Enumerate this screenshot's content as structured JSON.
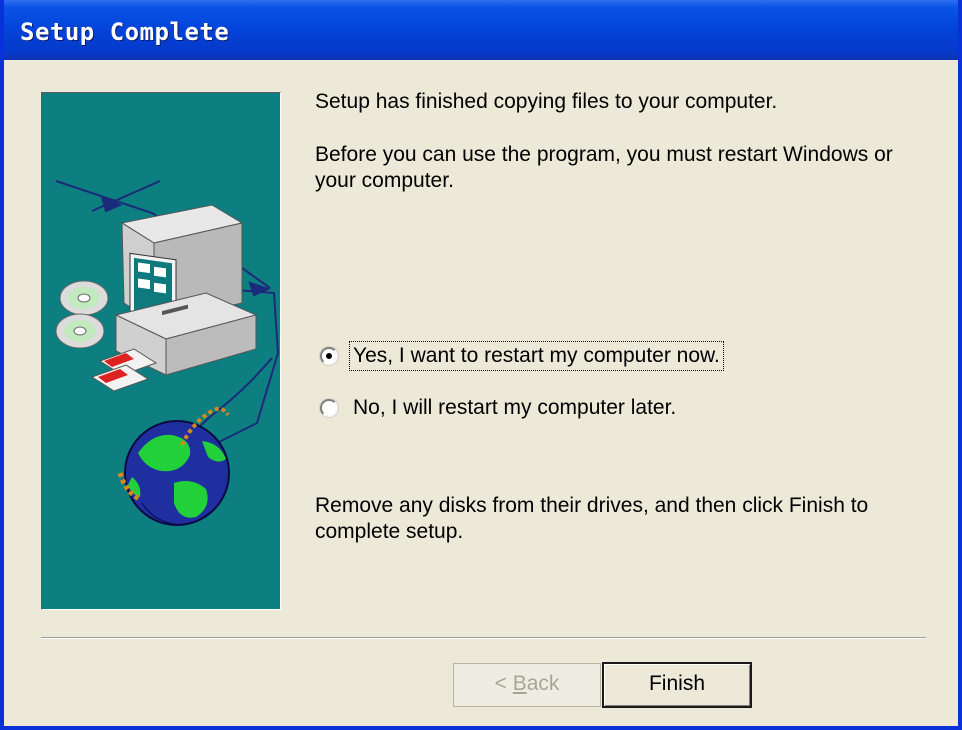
{
  "window": {
    "title": "Setup Complete"
  },
  "content": {
    "message_1": "Setup has finished copying files to your computer.",
    "message_2": "Before you can use the program, you must restart Windows or your computer.",
    "message_3": "Remove any disks from their drives, and then click Finish to complete setup."
  },
  "options": [
    {
      "label": "Yes, I want to restart my computer now.",
      "selected": true
    },
    {
      "label": "No, I will restart my computer later.",
      "selected": false
    }
  ],
  "buttons": {
    "back_prefix": "< ",
    "back_mnemonic": "B",
    "back_rest": "ack",
    "back_enabled": false,
    "finish_label": "Finish"
  },
  "colors": {
    "title_bar": "#0343d8",
    "side_panel": "#0d7f80",
    "dialog_bg": "#ece9d8"
  },
  "illustration": {
    "icons": [
      "computer-icon",
      "cd-disc-icon",
      "floppy-disk-icon",
      "globe-icon"
    ]
  }
}
